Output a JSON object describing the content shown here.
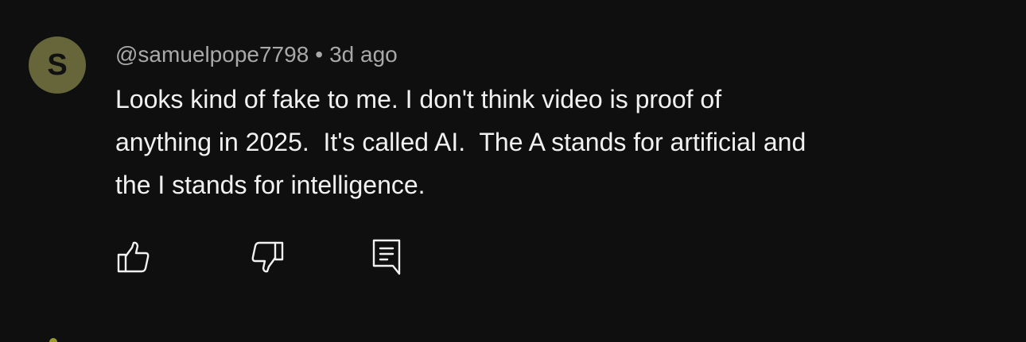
{
  "comment": {
    "avatar_letter": "S",
    "avatar_color": "#66663a",
    "author": "@samuelpope7798",
    "separator": "•",
    "timestamp": "3d ago",
    "text_lines": [
      "Looks kind of fake to me. I don't think video is proof of",
      "anything in 2025.  It's called AI.  The A stands for artificial and",
      "the I stands for intelligence."
    ],
    "actions": {
      "like_icon": "thumbs-up-icon",
      "dislike_icon": "thumbs-down-icon",
      "reply_icon": "comment-reply-icon"
    }
  }
}
